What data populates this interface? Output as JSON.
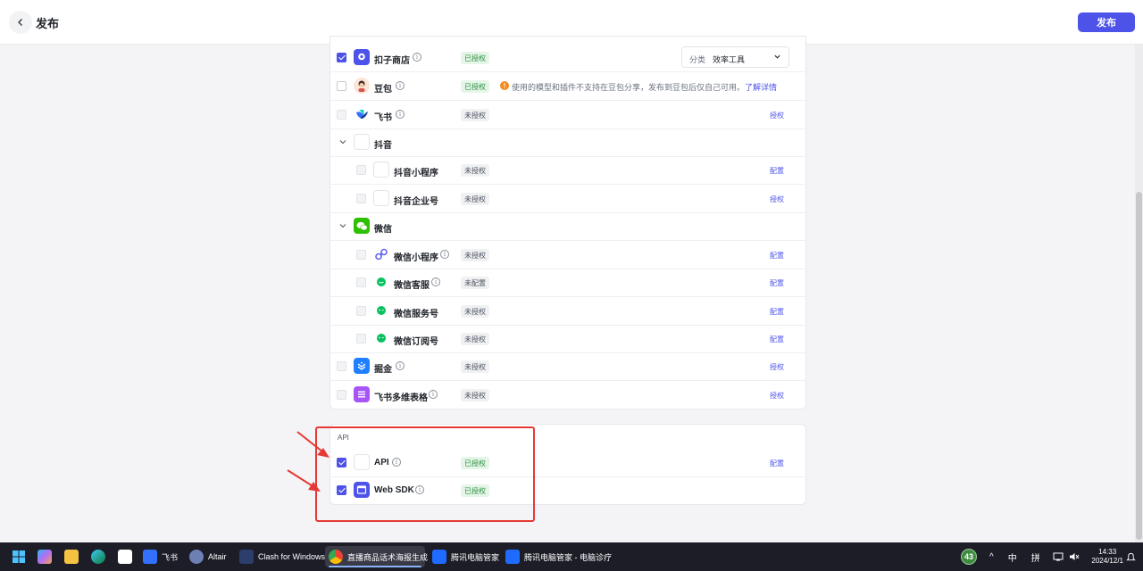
{
  "header": {
    "back_label": "‹",
    "title": "发布",
    "publish_label": "发布"
  },
  "select": {
    "label": "分类",
    "value": "效率工具"
  },
  "badges": {
    "authorized": "已授权",
    "unauthorized": "未授权",
    "unconfigured": "未配置"
  },
  "actions": {
    "configure": "配置",
    "authorize": "授权"
  },
  "platforms": {
    "kouzi": "扣子商店",
    "doubao": "豆包",
    "feishu": "飞书",
    "douyin": "抖音",
    "douyin_mini": "抖音小程序",
    "douyin_ent": "抖音企业号",
    "wechat": "微信",
    "wechat_mini": "微信小程序",
    "wechat_cs": "微信客服",
    "wechat_service": "微信服务号",
    "wechat_sub": "微信订阅号",
    "juejin": "掘金",
    "feishu_base": "飞书多维表格"
  },
  "warning": {
    "text": "使用的模型和插件不支持在豆包分享，发布到豆包后仅自己可用。",
    "link": "了解详情"
  },
  "api_section": {
    "title": "API",
    "api": "API",
    "web_sdk": "Web SDK"
  },
  "taskbar": {
    "feishu": "飞书",
    "altair": "Altair",
    "clash": "Clash for Windows",
    "chrome": "直播商品话术海报生成",
    "tencent1": "腾讯电脑管家",
    "tencent2": "腾讯电脑管家 - 电脑诊疗",
    "badge_count": "43",
    "ime1": "中",
    "ime2": "拼",
    "time": "14:33",
    "date": "2024/12/1"
  },
  "colors": {
    "accent": "#4d53e8",
    "authorized_bg": "#e5f6e8",
    "authorized_text": "#2f8f43",
    "annotation": "#e53935"
  }
}
